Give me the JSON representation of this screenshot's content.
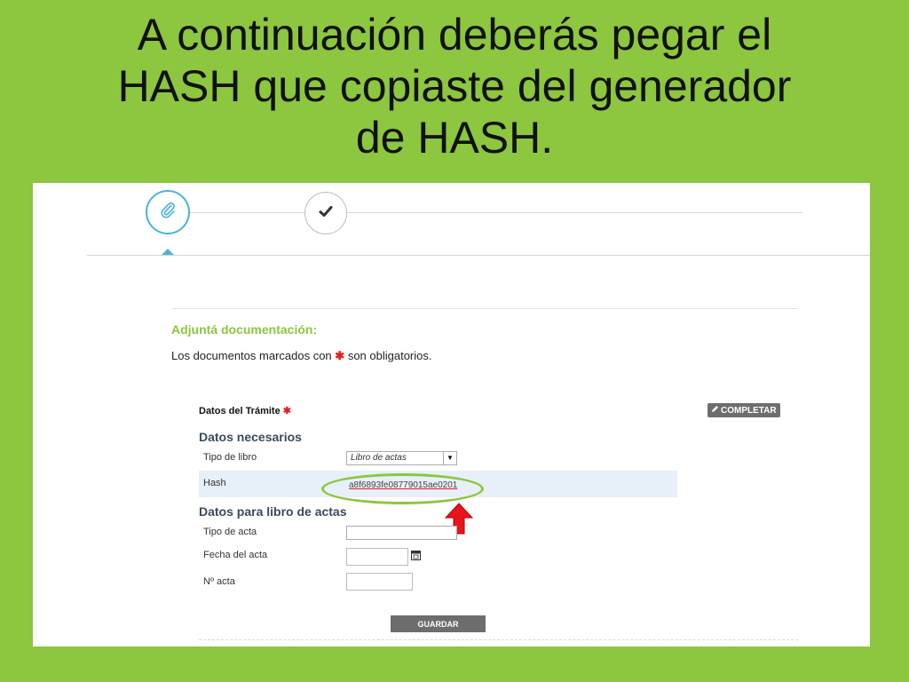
{
  "slide": {
    "title_lines": [
      "A continuación deberás pegar el",
      "HASH que copiaste del generador",
      "de HASH."
    ]
  },
  "steps": {
    "step1_icon": "paperclip-icon",
    "step2_icon": "check-icon"
  },
  "form": {
    "heading": "Adjuntá documentación:",
    "note_before": "Los documentos marcados con",
    "note_star": "✱",
    "note_after": "son obligatorios.",
    "section_label": "Datos del Trámite",
    "required_mark": "✱",
    "complete_button": "COMPLETAR",
    "group1_title": "Datos necesarios",
    "tipo_libro_label": "Tipo de libro",
    "tipo_libro_value": "Libro de actas",
    "hash_label": "Hash",
    "hash_value": "a8f6893fe08779015ae0201",
    "group2_title": "Datos para libro de actas",
    "tipo_acta_label": "Tipo de acta",
    "tipo_acta_value": "",
    "fecha_label": "Fecha del acta",
    "fecha_value": "",
    "nro_label": "Nº acta",
    "nro_value": "",
    "save_button": "GUARDAR"
  },
  "colors": {
    "background": "#8dc63f",
    "accent_blue": "#4bb3d8",
    "highlight_ellipse": "#8dc63f",
    "arrow_red": "#e8141b",
    "button_gray": "#6d6d6d"
  }
}
